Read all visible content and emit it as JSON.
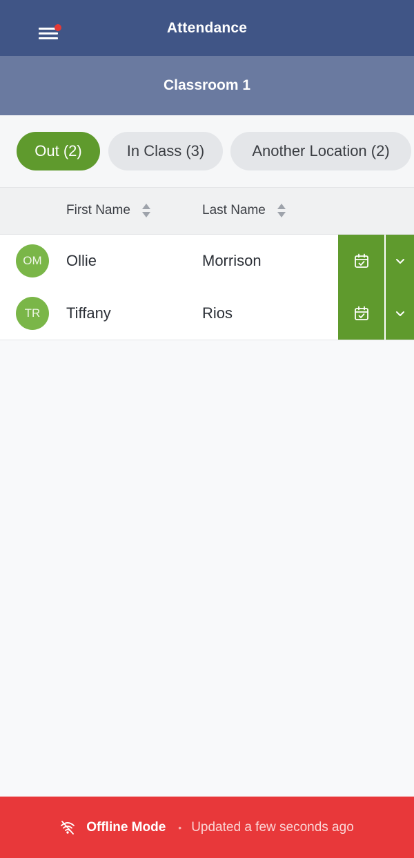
{
  "header": {
    "title": "Attendance"
  },
  "subheader": {
    "title": "Classroom 1"
  },
  "filters": [
    {
      "label": "Out (2)",
      "active": true
    },
    {
      "label": "In Class (3)",
      "active": false
    },
    {
      "label": "Another Location (2)",
      "active": false
    }
  ],
  "table": {
    "columns": [
      "First Name",
      "Last Name"
    ],
    "rows": [
      {
        "initials": "OM",
        "first": "Ollie",
        "last": "Morrison"
      },
      {
        "initials": "TR",
        "first": "Tiffany",
        "last": "Rios"
      }
    ]
  },
  "footer": {
    "status": "Offline Mode",
    "separator": "•",
    "updated": "Updated a few seconds ago"
  },
  "icons": {
    "menu": "hamburger-menu-icon",
    "sort": "sort-arrows-icon",
    "checkin": "calendar-check-icon",
    "expand": "chevron-down-icon",
    "offline": "wifi-off-icon"
  },
  "colors": {
    "header": "#405586",
    "subheader": "#6a7aa0",
    "accent": "#5f9a2d",
    "avatar": "#7ab648",
    "notification": "#e53935",
    "offline_banner": "#e8383a"
  }
}
